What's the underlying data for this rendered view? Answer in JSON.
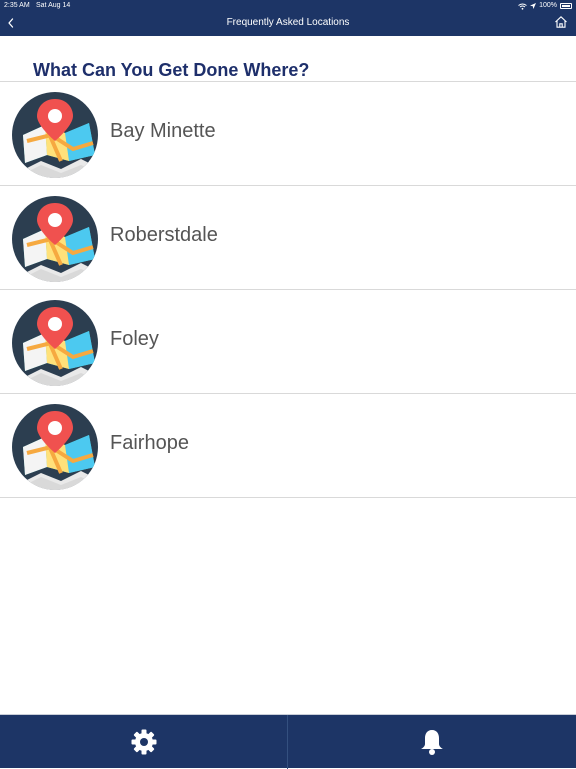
{
  "status_bar": {
    "time": "2:35 AM",
    "date": "Sat Aug 14",
    "battery": "100%"
  },
  "nav": {
    "title": "Frequently Asked Locations",
    "back_icon": "chevron-left-icon",
    "home_icon": "home-icon"
  },
  "page": {
    "heading": "What Can You Get Done Where?"
  },
  "locations": [
    {
      "label": "Bay Minette",
      "icon": "map-pin-icon"
    },
    {
      "label": "Roberstdale",
      "icon": "map-pin-icon"
    },
    {
      "label": "Foley",
      "icon": "map-pin-icon"
    },
    {
      "label": "Fairhope",
      "icon": "map-pin-icon"
    }
  ],
  "tab_bar": {
    "items": [
      {
        "icon": "gear-icon"
      },
      {
        "icon": "bell-icon"
      }
    ]
  },
  "colors": {
    "nav_background": "#1d3566",
    "heading_text": "#1e2f6b",
    "item_text": "#555555",
    "divider": "#d9d9d9"
  }
}
